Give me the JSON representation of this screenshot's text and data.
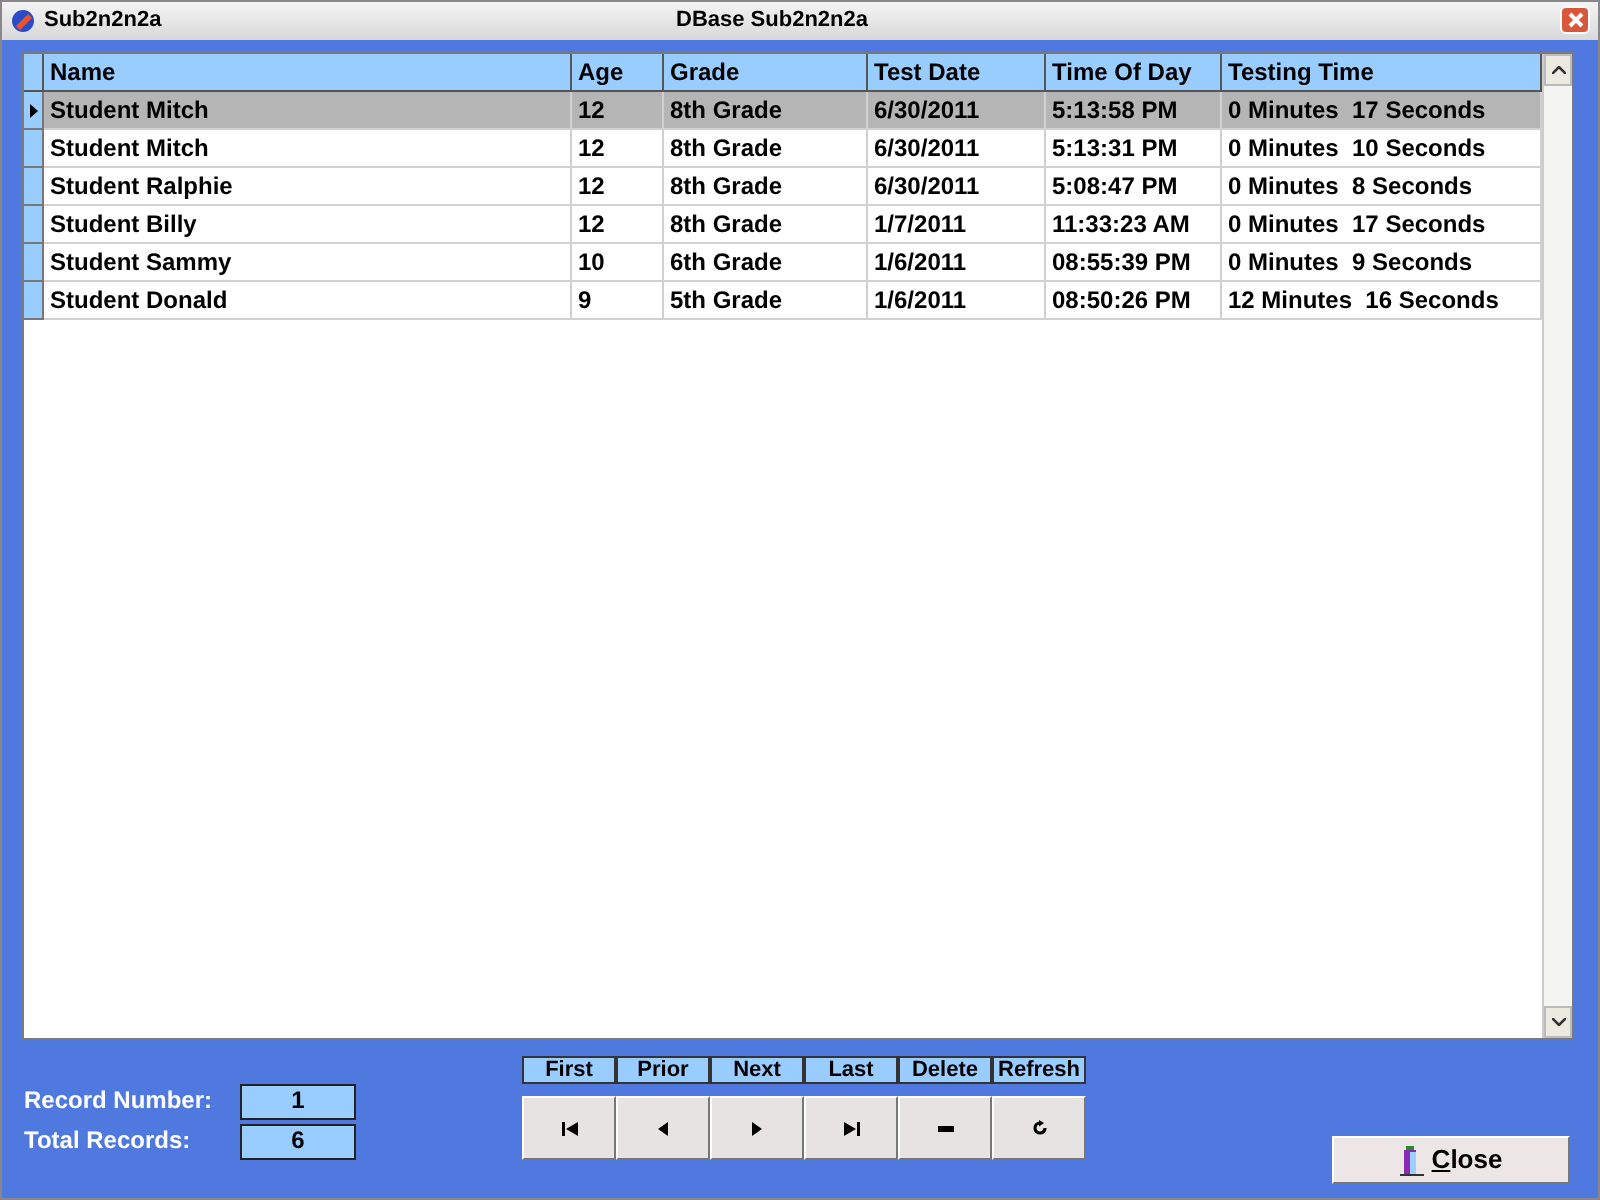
{
  "window": {
    "title": "Sub2n2n2a",
    "caption": "DBase Sub2n2n2a"
  },
  "table": {
    "columns": [
      "Name",
      "Age",
      "Grade",
      "Test Date",
      "Time Of Day",
      "Testing Time"
    ],
    "rows": [
      {
        "selected": true,
        "cells": [
          "Student Mitch",
          "12",
          "8th Grade",
          "6/30/2011",
          "5:13:58 PM",
          "0 Minutes  17 Seconds"
        ]
      },
      {
        "selected": false,
        "cells": [
          "Student Mitch",
          "12",
          "8th Grade",
          "6/30/2011",
          "5:13:31 PM",
          "0 Minutes  10 Seconds"
        ]
      },
      {
        "selected": false,
        "cells": [
          "Student Ralphie",
          "12",
          "8th Grade",
          "6/30/2011",
          "5:08:47 PM",
          "0 Minutes  8 Seconds"
        ]
      },
      {
        "selected": false,
        "cells": [
          "Student Billy",
          "12",
          "8th Grade",
          "1/7/2011",
          "11:33:23 AM",
          "0 Minutes  17 Seconds"
        ]
      },
      {
        "selected": false,
        "cells": [
          "Student Sammy",
          "10",
          "6th Grade",
          "1/6/2011",
          "08:55:39 PM",
          "0 Minutes  9 Seconds"
        ]
      },
      {
        "selected": false,
        "cells": [
          "Student Donald",
          "9",
          "5th Grade",
          "1/6/2011",
          "08:50:26 PM",
          "12 Minutes  16 Seconds"
        ]
      }
    ]
  },
  "record_number": {
    "label": "Record Number:",
    "value": "1"
  },
  "total_records": {
    "label": "Total Records:",
    "value": "6"
  },
  "navigator": [
    {
      "kind": "first",
      "label": "First"
    },
    {
      "kind": "prior",
      "label": "Prior"
    },
    {
      "kind": "next",
      "label": "Next"
    },
    {
      "kind": "last",
      "label": "Last"
    },
    {
      "kind": "delete",
      "label": "Delete"
    },
    {
      "kind": "refresh",
      "label": "Refresh"
    }
  ],
  "close_button": {
    "label": "Close"
  }
}
